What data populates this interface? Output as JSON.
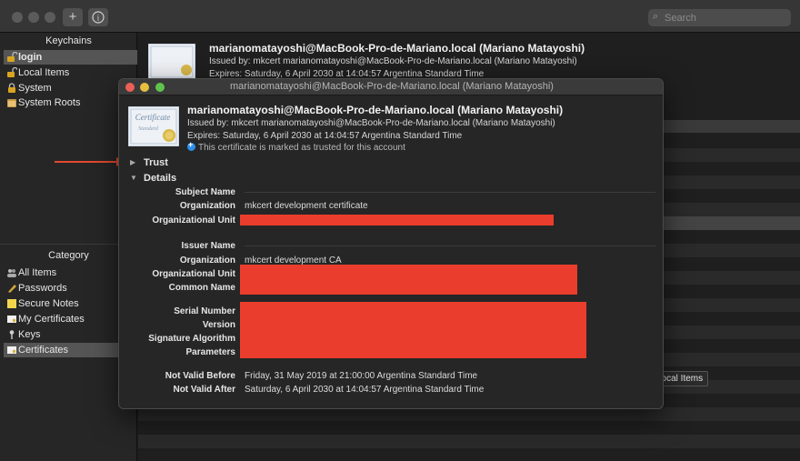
{
  "toolbar": {
    "add_symbol": "+",
    "info_symbol": "i",
    "search_placeholder": "Search"
  },
  "sidebar": {
    "keychains_header": "Keychains",
    "keychains": [
      {
        "label": "login",
        "icon": "lock-open-icon",
        "selected": true
      },
      {
        "label": "Local Items",
        "icon": "lock-open-icon"
      },
      {
        "label": "System",
        "icon": "lock-icon"
      },
      {
        "label": "System Roots",
        "icon": "folder-icon"
      }
    ],
    "category_header": "Category",
    "categories": [
      {
        "label": "All Items",
        "icon": "people-icon"
      },
      {
        "label": "Passwords",
        "icon": "pen-icon"
      },
      {
        "label": "Secure Notes",
        "icon": "note-icon"
      },
      {
        "label": "My Certificates",
        "icon": "certificate-icon"
      },
      {
        "label": "Keys",
        "icon": "key-icon"
      },
      {
        "label": "Certificates",
        "icon": "certificate-icon",
        "selected": true
      }
    ]
  },
  "main_header": {
    "title": "marianomatayoshi@MacBook-Pro-de-Mariano.local (Mariano Matayoshi)",
    "issued_by": "Issued by: mkcert marianomatayoshi@MacBook-Pro-de-Mariano.local (Mariano Matayoshi)",
    "expires": "Expires: Saturday, 6 April 2030 at 14:04:57 Argentina Standard Time"
  },
  "tooltip": "Local Items",
  "dialog": {
    "window_title": "marianomatayoshi@MacBook-Pro-de-Mariano.local (Mariano Matayoshi)",
    "cert_title": "marianomatayoshi@MacBook-Pro-de-Mariano.local (Mariano Matayoshi)",
    "issued_by": "Issued by: mkcert marianomatayoshi@MacBook-Pro-de-Mariano.local (Mariano Matayoshi)",
    "expires": "Expires: Saturday, 6 April 2030 at 14:04:57 Argentina Standard Time",
    "trust_status": "This certificate is marked as trusted for this account",
    "cert_icon_text_1": "Certificate",
    "cert_icon_text_2": "Standard",
    "disclosure_collapsed": "▶",
    "disclosure_expanded": "▼",
    "trust_label": "Trust",
    "details_label": "Details",
    "subject_name_header": "Subject Name",
    "subject": {
      "organization_label": "Organization",
      "organization_value": "mkcert development certificate",
      "org_unit_label": "Organizational Unit"
    },
    "issuer_name_header": "Issuer Name",
    "issuer": {
      "organization_label": "Organization",
      "organization_value": "mkcert development CA",
      "org_unit_label": "Organizational Unit",
      "common_name_label": "Common Name"
    },
    "serial_number_label": "Serial Number",
    "version_label": "Version",
    "signature_algorithm_label": "Signature Algorithm",
    "parameters_label": "Parameters",
    "not_valid_before_label": "Not Valid Before",
    "not_valid_before_value": "Friday, 31 May 2019 at 21:00:00 Argentina Standard Time",
    "not_valid_after_label": "Not Valid After",
    "not_valid_after_value": "Saturday, 6 April 2030 at 14:04:57 Argentina Standard Time"
  },
  "colors": {
    "redaction": "#ea3d2d",
    "annotation_arrow": "#e24a2f",
    "traffic_close": "#ec5f56",
    "traffic_minimize": "#e6bf3f",
    "traffic_zoom": "#5fc24c",
    "trust_badge": "#2d8ee8"
  }
}
